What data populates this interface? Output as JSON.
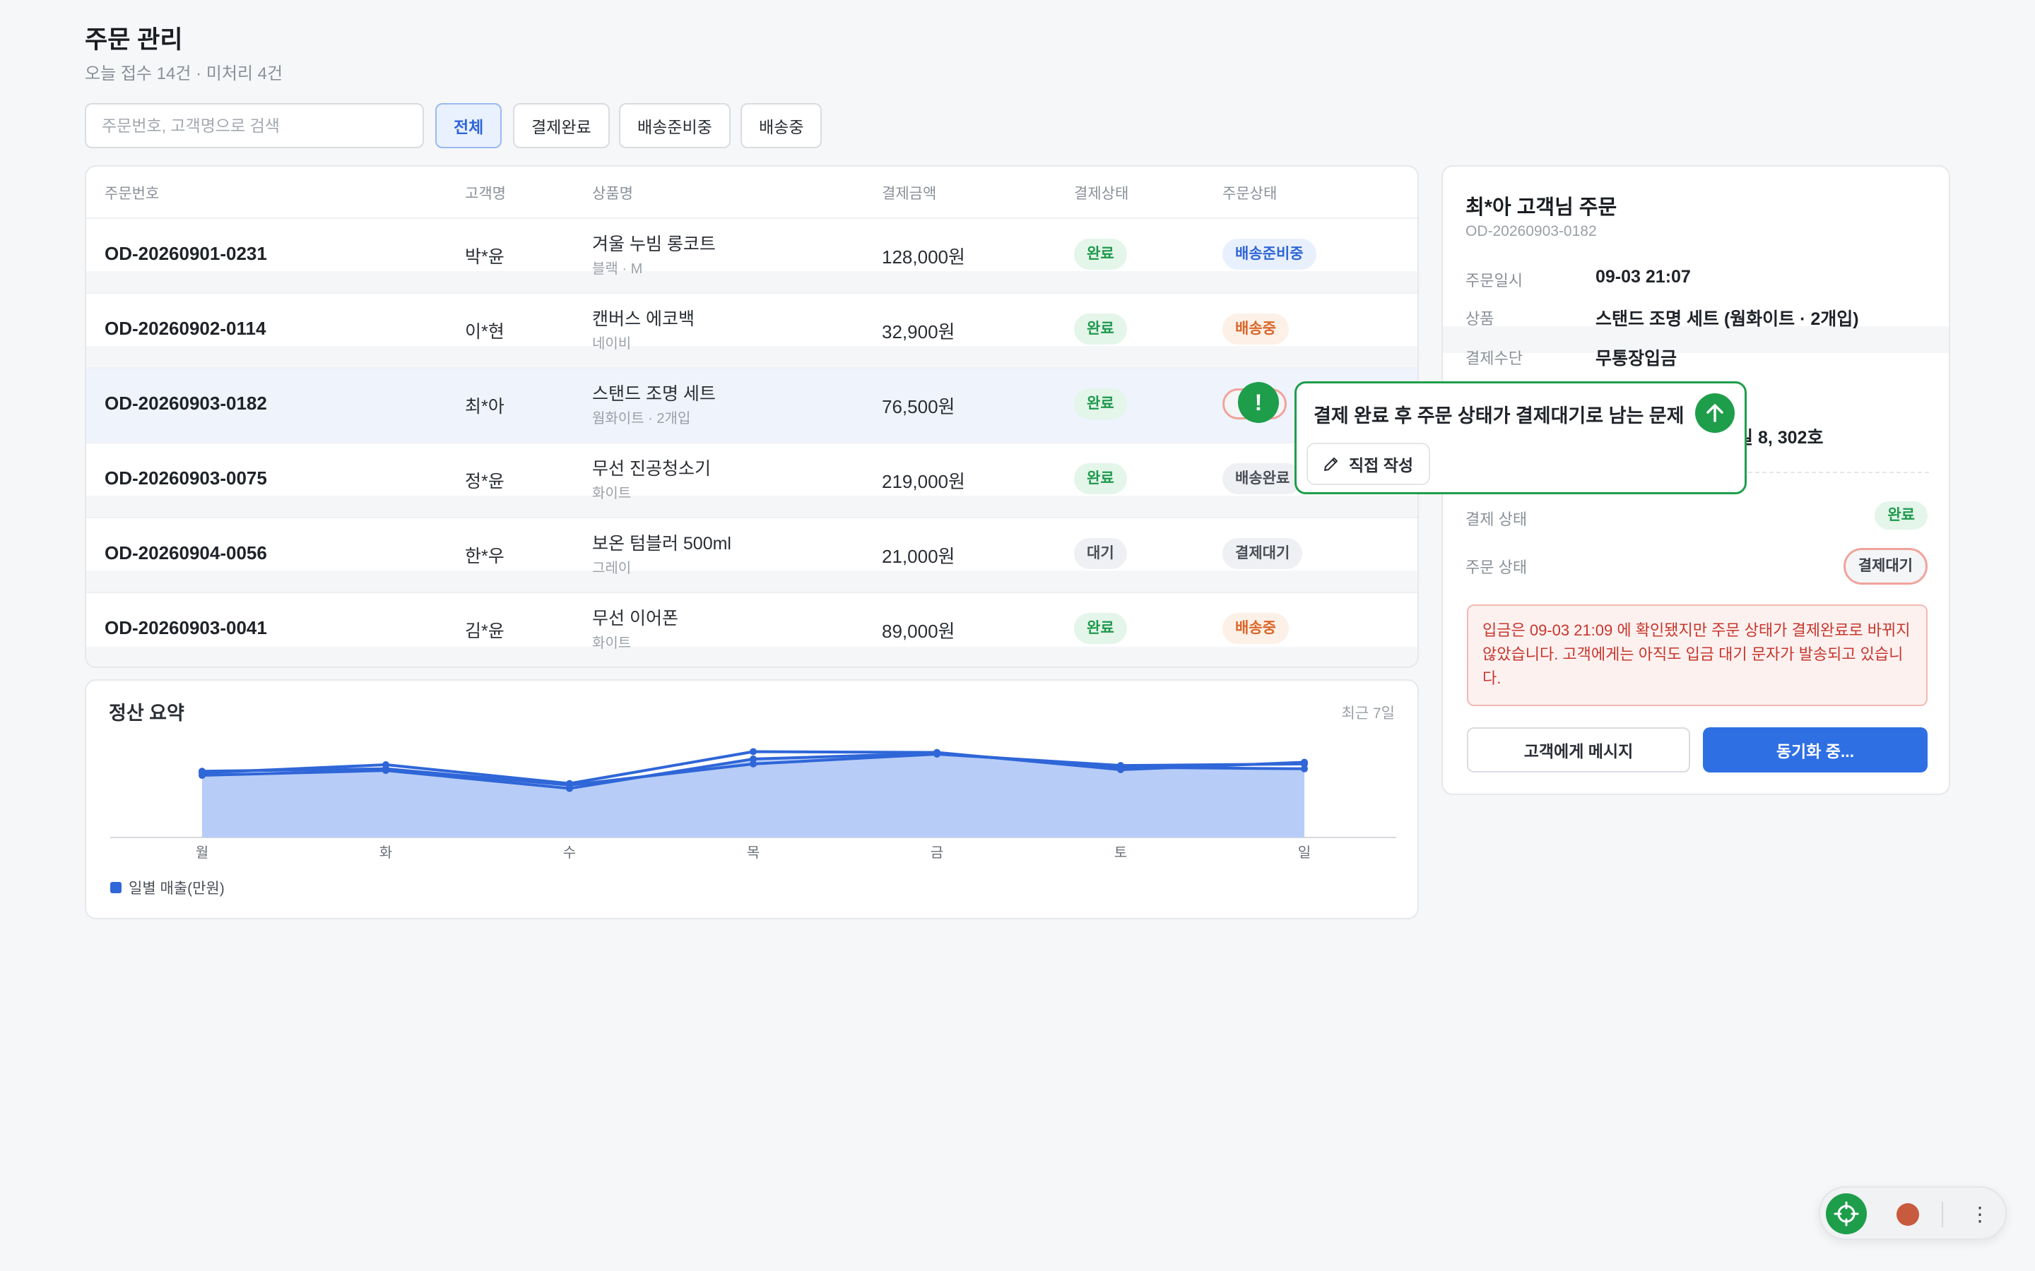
{
  "header": {
    "title": "주문 관리",
    "subtitle": "오늘 접수 14건 · 미처리 4건"
  },
  "search": {
    "placeholder": "주문번호, 고객명으로 검색"
  },
  "filters": [
    "전체",
    "결제완료",
    "배송준비중",
    "배송중"
  ],
  "table": {
    "columns": [
      "주문번호",
      "고객명",
      "상품명",
      "결제금액",
      "결제상태",
      "주문상태"
    ],
    "rows": [
      {
        "order_no": "OD-20260901-0231",
        "customer": "박*윤",
        "product": "겨울 누빔 롱코트",
        "option": "블랙 · M",
        "amount": "128,000원",
        "pay_status": "완료",
        "order_status": "배송준비중"
      },
      {
        "order_no": "OD-20260902-0114",
        "customer": "이*현",
        "product": "캔버스 에코백",
        "option": "네이비",
        "amount": "32,900원",
        "pay_status": "완료",
        "order_status": "배송중"
      },
      {
        "order_no": "OD-20260903-0182",
        "customer": "최*아",
        "product": "스탠드 조명 세트",
        "option": "웜화이트 · 2개입",
        "amount": "76,500원",
        "pay_status": "완료",
        "order_status": "결제대기"
      },
      {
        "order_no": "OD-20260903-0075",
        "customer": "정*윤",
        "product": "무선 진공청소기",
        "option": "화이트",
        "amount": "219,000원",
        "pay_status": "완료",
        "order_status": "배송완료"
      },
      {
        "order_no": "OD-20260904-0056",
        "customer": "한*우",
        "product": "보온 텀블러 500ml",
        "option": "그레이",
        "amount": "21,000원",
        "pay_status": "대기",
        "order_status": "결제대기"
      },
      {
        "order_no": "OD-20260903-0041",
        "customer": "김*윤",
        "product": "무선 이어폰",
        "option": "화이트",
        "amount": "89,000원",
        "pay_status": "완료",
        "order_status": "배송중"
      }
    ]
  },
  "summary": {
    "title": "정산 요약",
    "range": "최근 7일",
    "legend": "일별 매출(만원)"
  },
  "chart_data": {
    "type": "area",
    "categories": [
      "월",
      "화",
      "수",
      "목",
      "금",
      "토",
      "일"
    ],
    "series": [
      {
        "name": "일별 매출(만원)",
        "values": [
          76,
          82,
          60,
          96,
          103,
          86,
          84
        ]
      },
      {
        "values": [
          81,
          84,
          64,
          90,
          102,
          88,
          90
        ]
      },
      {
        "values": [
          79,
          89,
          66,
          105,
          104,
          83,
          92
        ]
      }
    ],
    "ylim": [
      0,
      140
    ],
    "grid": false,
    "legend_position": "bottom-left",
    "color": "#2f66d8",
    "fill": "#b7cdf7"
  },
  "detail": {
    "title": "최*아 고객님 주문",
    "order_id": "OD-20260903-0182",
    "order_date_label": "주문일시",
    "order_date": "09-03 21:07",
    "product_label": "상품",
    "product": "스탠드 조명 세트 (웜화이트 · 2개입)",
    "payment_label": "결제수단",
    "payment": "무통장입금",
    "address_partial": "길 8, 302호",
    "pay_status_label": "결제 상태",
    "pay_status": "완료",
    "order_status_label": "주문 상태",
    "order_status": "결제대기",
    "alert": "입금은 09-03 21:09 에 확인됐지만 주문 상태가 결제완료로 바뀌지 않았습니다. 고객에게는 아직도 입금 대기 문자가 발송되고 있습니다.",
    "message_button": "고객에게 메시지",
    "sync_button": "동기화 중..."
  },
  "popover": {
    "warning_symbol": "!",
    "text": "결제 완료 후 주문 상태가 결제대기로 남는 문제",
    "write_button": "직접 작성",
    "row_badge_fragment": "결"
  },
  "toolbar": {
    "more": "⋮"
  },
  "colors": {
    "primary": "#2f6fe4",
    "agent_green": "#1e9e4a",
    "alert_red": "#c7362b"
  }
}
